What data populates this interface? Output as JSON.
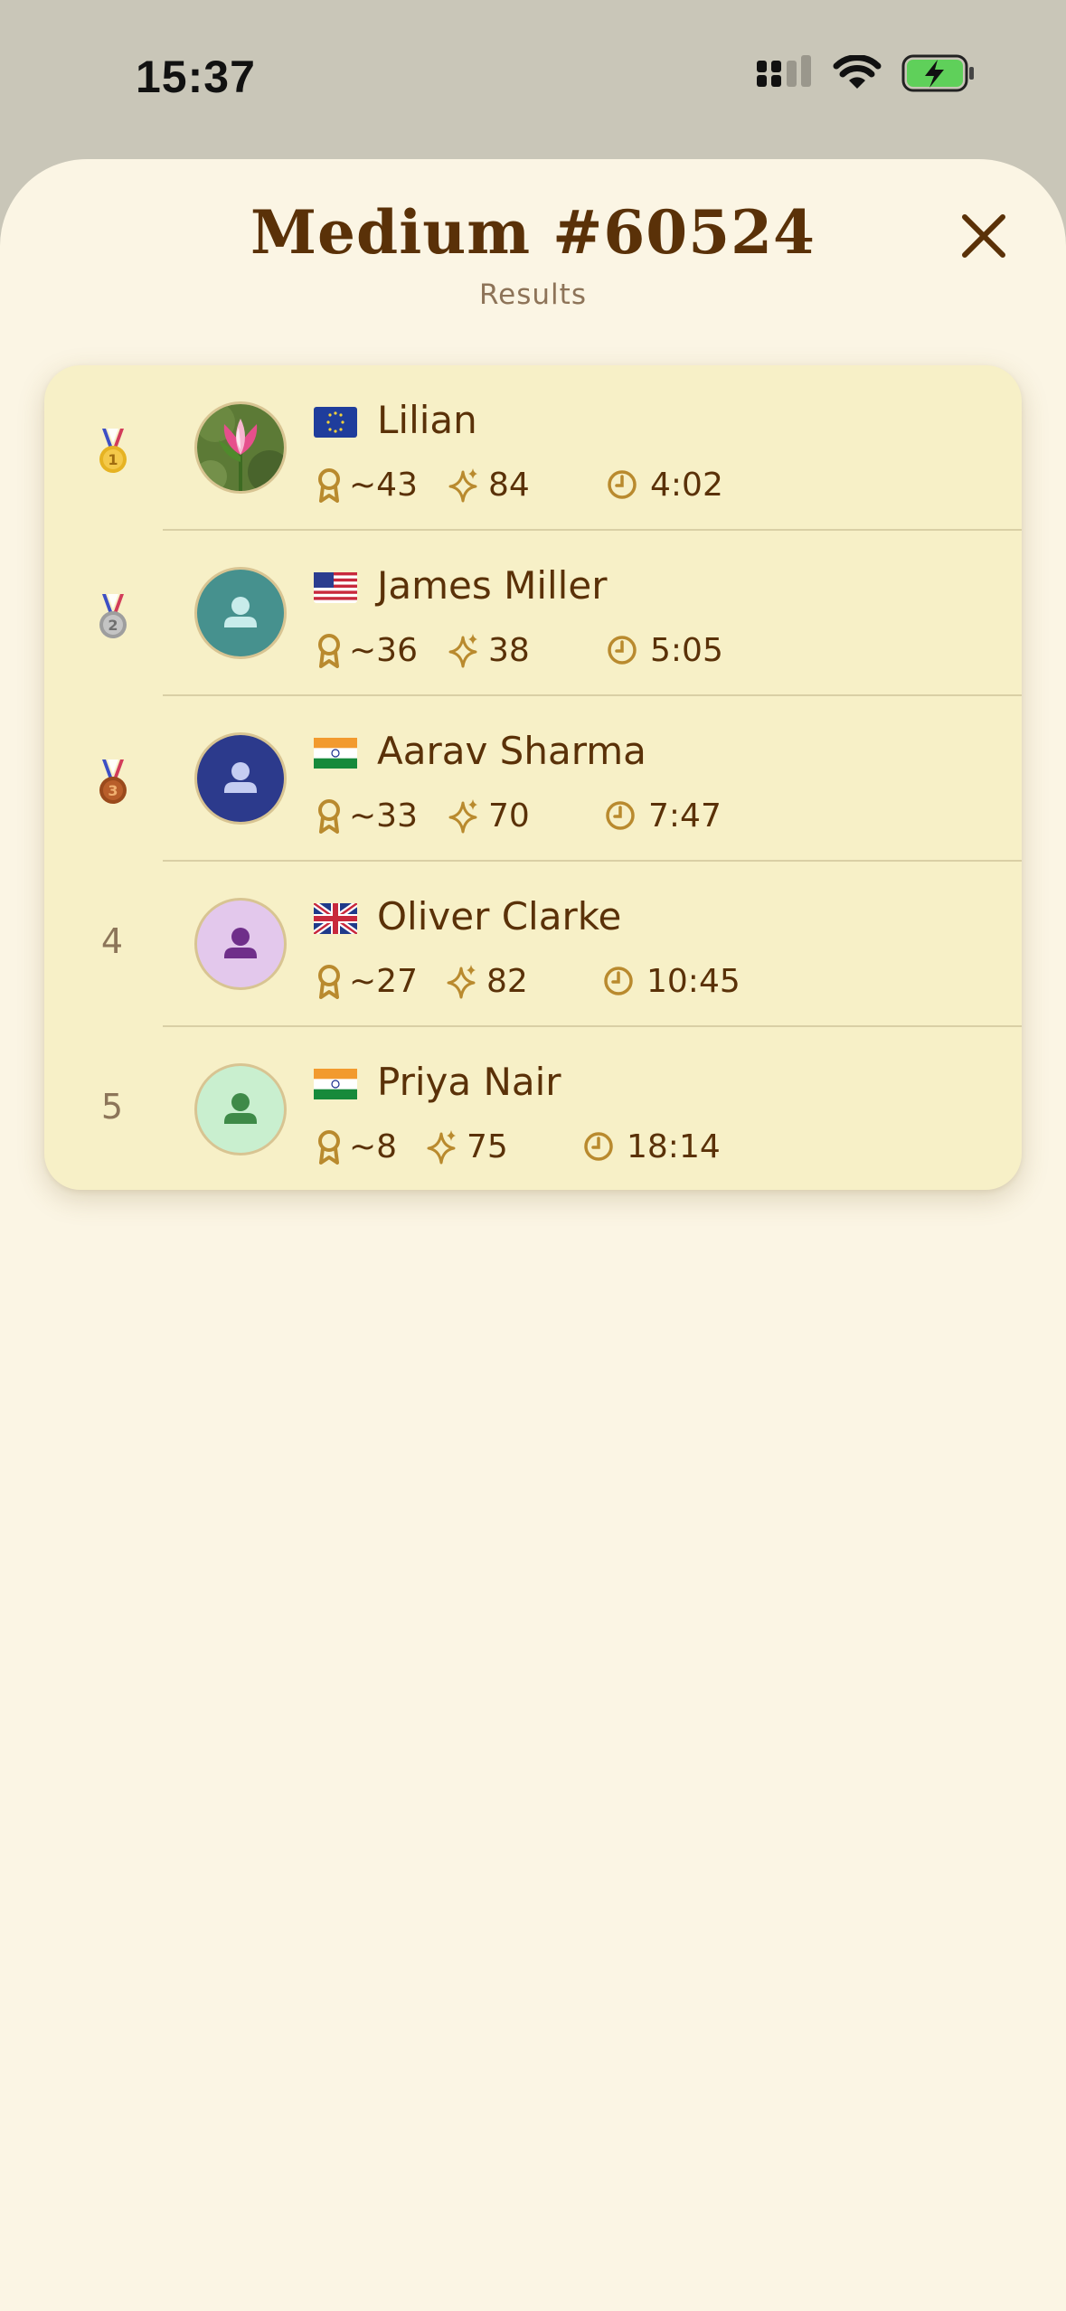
{
  "status_bar": {
    "time": "15:37",
    "icons": [
      "cellular-signal-icon",
      "wifi-icon",
      "battery-charging-icon"
    ],
    "battery_color": "#5fd05a"
  },
  "sheet": {
    "title": "Medium #60524",
    "subtitle": "Results",
    "close_icon": "close-icon"
  },
  "results": [
    {
      "rank": "1",
      "medal": "gold",
      "avatar": "tulip-photo",
      "flag": "EU",
      "name": "Lilian",
      "score": "~43",
      "stars": "84",
      "time": "4:02"
    },
    {
      "rank": "2",
      "medal": "silver",
      "avatar": "person-icon",
      "avatar_bg": "#46918e",
      "avatar_fg": "#c8eceb",
      "flag": "US",
      "name": "James Miller",
      "score": "~36",
      "stars": "38",
      "time": "5:05"
    },
    {
      "rank": "3",
      "medal": "bronze",
      "avatar": "person-icon",
      "avatar_bg": "#2c3a8c",
      "avatar_fg": "#c5cdf2",
      "flag": "IN",
      "name": "Aarav Sharma",
      "score": "~33",
      "stars": "70",
      "time": "7:47"
    },
    {
      "rank": "4",
      "medal": null,
      "avatar": "person-icon",
      "avatar_bg": "#e3c8ec",
      "avatar_fg": "#6f2f8a",
      "flag": "GB",
      "name": "Oliver Clarke",
      "score": "~27",
      "stars": "82",
      "time": "10:45"
    },
    {
      "rank": "5",
      "medal": null,
      "avatar": "person-icon",
      "avatar_bg": "#c9efcf",
      "avatar_fg": "#3e8a48",
      "flag": "IN",
      "name": "Priya Nair",
      "score": "~8",
      "stars": "75",
      "time": "18:14"
    }
  ],
  "stat_icons": [
    "award-ribbon-icon",
    "sparkle-icon",
    "clock-icon"
  ],
  "colors": {
    "accent_text": "#5a3108",
    "icon_gold": "#b98a2e",
    "card_bg": "#f7f0c7",
    "sheet_bg": "#fbf5e4"
  }
}
